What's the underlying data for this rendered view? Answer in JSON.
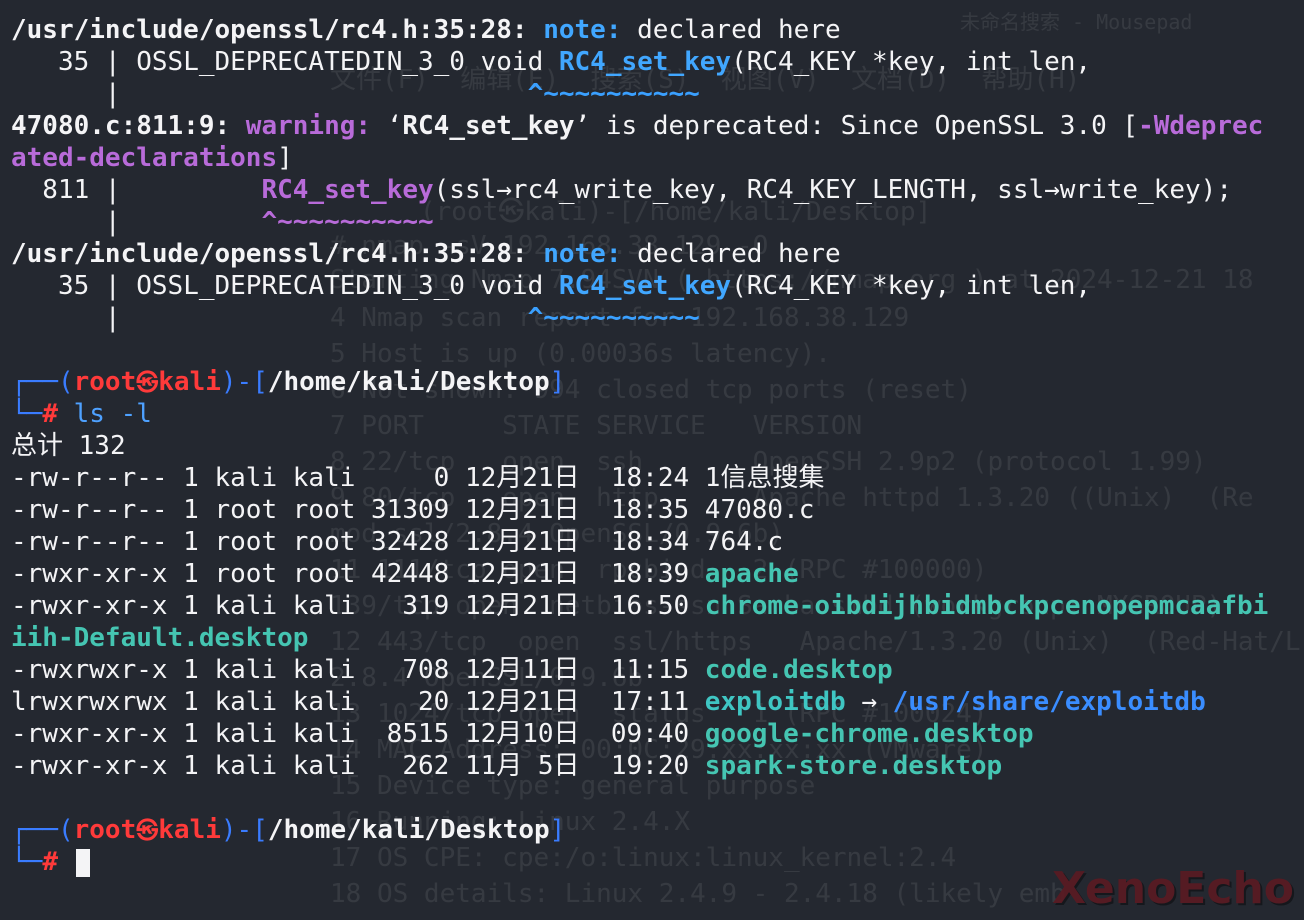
{
  "background_ghost_lines": [
    "未命名搜索 - Mousepad",
    "文件(F)  编辑(E)  搜索(S)  视图(V)  文档(D)  帮助(H)",
    "(root㉿kali)-[/home/kali/Desktop]",
    "# nmap -sV 192.168.38.129 -O",
    "Starting Nmap 7.94SVN ( https://nmap.org ) at 2024-12-21 18",
    "4 Nmap scan report for 192.168.38.129",
    "5 Host is up (0.00036s latency).",
    "6 Not shown: 994 closed tcp ports (reset)",
    "7 PORT     STATE SERVICE   VERSION",
    "8 22/tcp   open  ssh       OpenSSH 2.9p2 (protocol 1.99)",
    "9 80/tcp   open  http      Apache httpd 1.3.20 ((Unix)  (Re",
    "mod_ssl/2.8.4 OpenSSL/0.9.6b)",
    "11 111/tcp open  rpcbind   2 (RPC #100000)",
    "139/tcp open  netbios-ssn Samba smbd (workgroup: MYGROUP)",
    "12 443/tcp  open  ssl/https   Apache/1.3.20 (Unix)  (Red-Hat/L",
    "2.8.4 OpenSSL/0.9.6b",
    "13 1024/tcp open  status   1 (RPC #100024)",
    "14 MAC Address: 00:0C:29:xx:xx:xx (VMware)",
    "15 Device type: general purpose",
    "16 Running: Linux 2.4.X",
    "17 OS CPE: cpe:/o:linux:linux_kernel:2.4",
    "18 OS details: Linux 2.4.9 - 2.4.18 (likely emb"
  ],
  "terminal": {
    "block1": {
      "path": "/usr/include/openssl/rc4.h:35:28:",
      "note": "note:",
      "note_text": " declared here",
      "line_no": "   35 | ",
      "code_before": "OSSL_DEPRECATEDIN_3_0 void ",
      "func": "RC4_set_key",
      "code_after": "(RC4_KEY *key, int len,",
      "bar": "      | ",
      "marker": "                         ^~~~~~~~~~~"
    },
    "block2": {
      "loc": "47080.c:811:9:",
      "warning": " warning:",
      "msg_a": " ‘",
      "func": "RC4_set_key",
      "msg_b": "’ is deprecated: Since OpenSSL 3.0 [",
      "flag_1": "-Wdeprec",
      "flag_2": "ated-declarations",
      "close": "]",
      "line_no": "  811 | ",
      "indent": "        ",
      "func_call": "RC4_set_key",
      "call_args": "(ssl→rc4_write_key, RC4_KEY_LENGTH, ssl→write_key);",
      "bar": "      | ",
      "marker": "        ^~~~~~~~~~~"
    },
    "block3": {
      "path": "/usr/include/openssl/rc4.h:35:28:",
      "note": "note:",
      "note_text": " declared here",
      "line_no": "   35 | ",
      "code_before": "OSSL_DEPRECATEDIN_3_0 void ",
      "func": "RC4_set_key",
      "code_after": "(RC4_KEY *key, int len,",
      "bar": "      | ",
      "marker": "                         ^~~~~~~~~~~"
    },
    "prompt1": {
      "open": "┌──(",
      "user": "root",
      "skull": "㉿",
      "host": "kali",
      "mid": ")-[",
      "cwd": "/home/kali/Desktop",
      "close": "]",
      "hash_prefix": "└─",
      "hash": "#",
      "command": " ls -l"
    },
    "total": "总计 132",
    "listing": [
      {
        "perms": "-rw-r--r--",
        "links": "1",
        "owner": "kali",
        "group": "kali",
        "size": "    0",
        "month": "12月",
        "day": "21日",
        "time": "18:24",
        "name": "1信息搜集",
        "kind": "plain"
      },
      {
        "perms": "-rw-r--r--",
        "links": "1",
        "owner": "root",
        "group": "root",
        "size": "31309",
        "month": "12月",
        "day": "21日",
        "time": "18:35",
        "name": "47080.c",
        "kind": "plain"
      },
      {
        "perms": "-rw-r--r--",
        "links": "1",
        "owner": "root",
        "group": "root",
        "size": "32428",
        "month": "12月",
        "day": "21日",
        "time": "18:34",
        "name": "764.c",
        "kind": "plain"
      },
      {
        "perms": "-rwxr-xr-x",
        "links": "1",
        "owner": "root",
        "group": "root",
        "size": "42448",
        "month": "12月",
        "day": "21日",
        "time": "18:39",
        "name": "apache",
        "kind": "exec"
      },
      {
        "perms": "-rwxr-xr-x",
        "links": "1",
        "owner": "kali",
        "group": "kali",
        "size": "  319",
        "month": "12月",
        "day": "21日",
        "time": "16:50",
        "name": "chrome-oibdijhbidmbckpcenopepmcaafbi",
        "name_wrap": "iih-Default.desktop",
        "kind": "exec"
      },
      {
        "perms": "-rwxrwxr-x",
        "links": "1",
        "owner": "kali",
        "group": "kali",
        "size": "  708",
        "month": "12月",
        "day": "11日",
        "time": "11:15",
        "name": "code.desktop",
        "kind": "exec"
      },
      {
        "perms": "lrwxrwxrwx",
        "links": "1",
        "owner": "kali",
        "group": "kali",
        "size": "   20",
        "month": "12月",
        "day": "21日",
        "time": "17:11",
        "name": "exploitdb",
        "arrow": " → ",
        "target": "/usr/share/exploitdb",
        "kind": "link"
      },
      {
        "perms": "-rwxr-xr-x",
        "links": "1",
        "owner": "kali",
        "group": "kali",
        "size": " 8515",
        "month": "12月",
        "day": "10日",
        "time": "09:40",
        "name": "google-chrome.desktop",
        "kind": "exec"
      },
      {
        "perms": "-rwxr-xr-x",
        "links": "1",
        "owner": "kali",
        "group": "kali",
        "size": "  262",
        "month": "11月",
        "day": " 5日",
        "time": "19:20",
        "name": "spark-store.desktop",
        "kind": "exec"
      }
    ],
    "prompt2": {
      "open": "┌──(",
      "user": "root",
      "skull": "㉿",
      "host": "kali",
      "mid": ")-[",
      "cwd": "/home/kali/Desktop",
      "close": "]",
      "hash_prefix": "└─",
      "hash": "#",
      "command": " "
    }
  },
  "watermark": "XenoEcho",
  "colors": {
    "background": "#242830",
    "note": "#41a7ff",
    "warning": "#b86bd9",
    "function": "#41a7ff",
    "exec_file": "#45c5b2",
    "symlink_target": "#3a8dff",
    "prompt_user": "#ff3a3a",
    "prompt_frame": "#3a7cff"
  }
}
